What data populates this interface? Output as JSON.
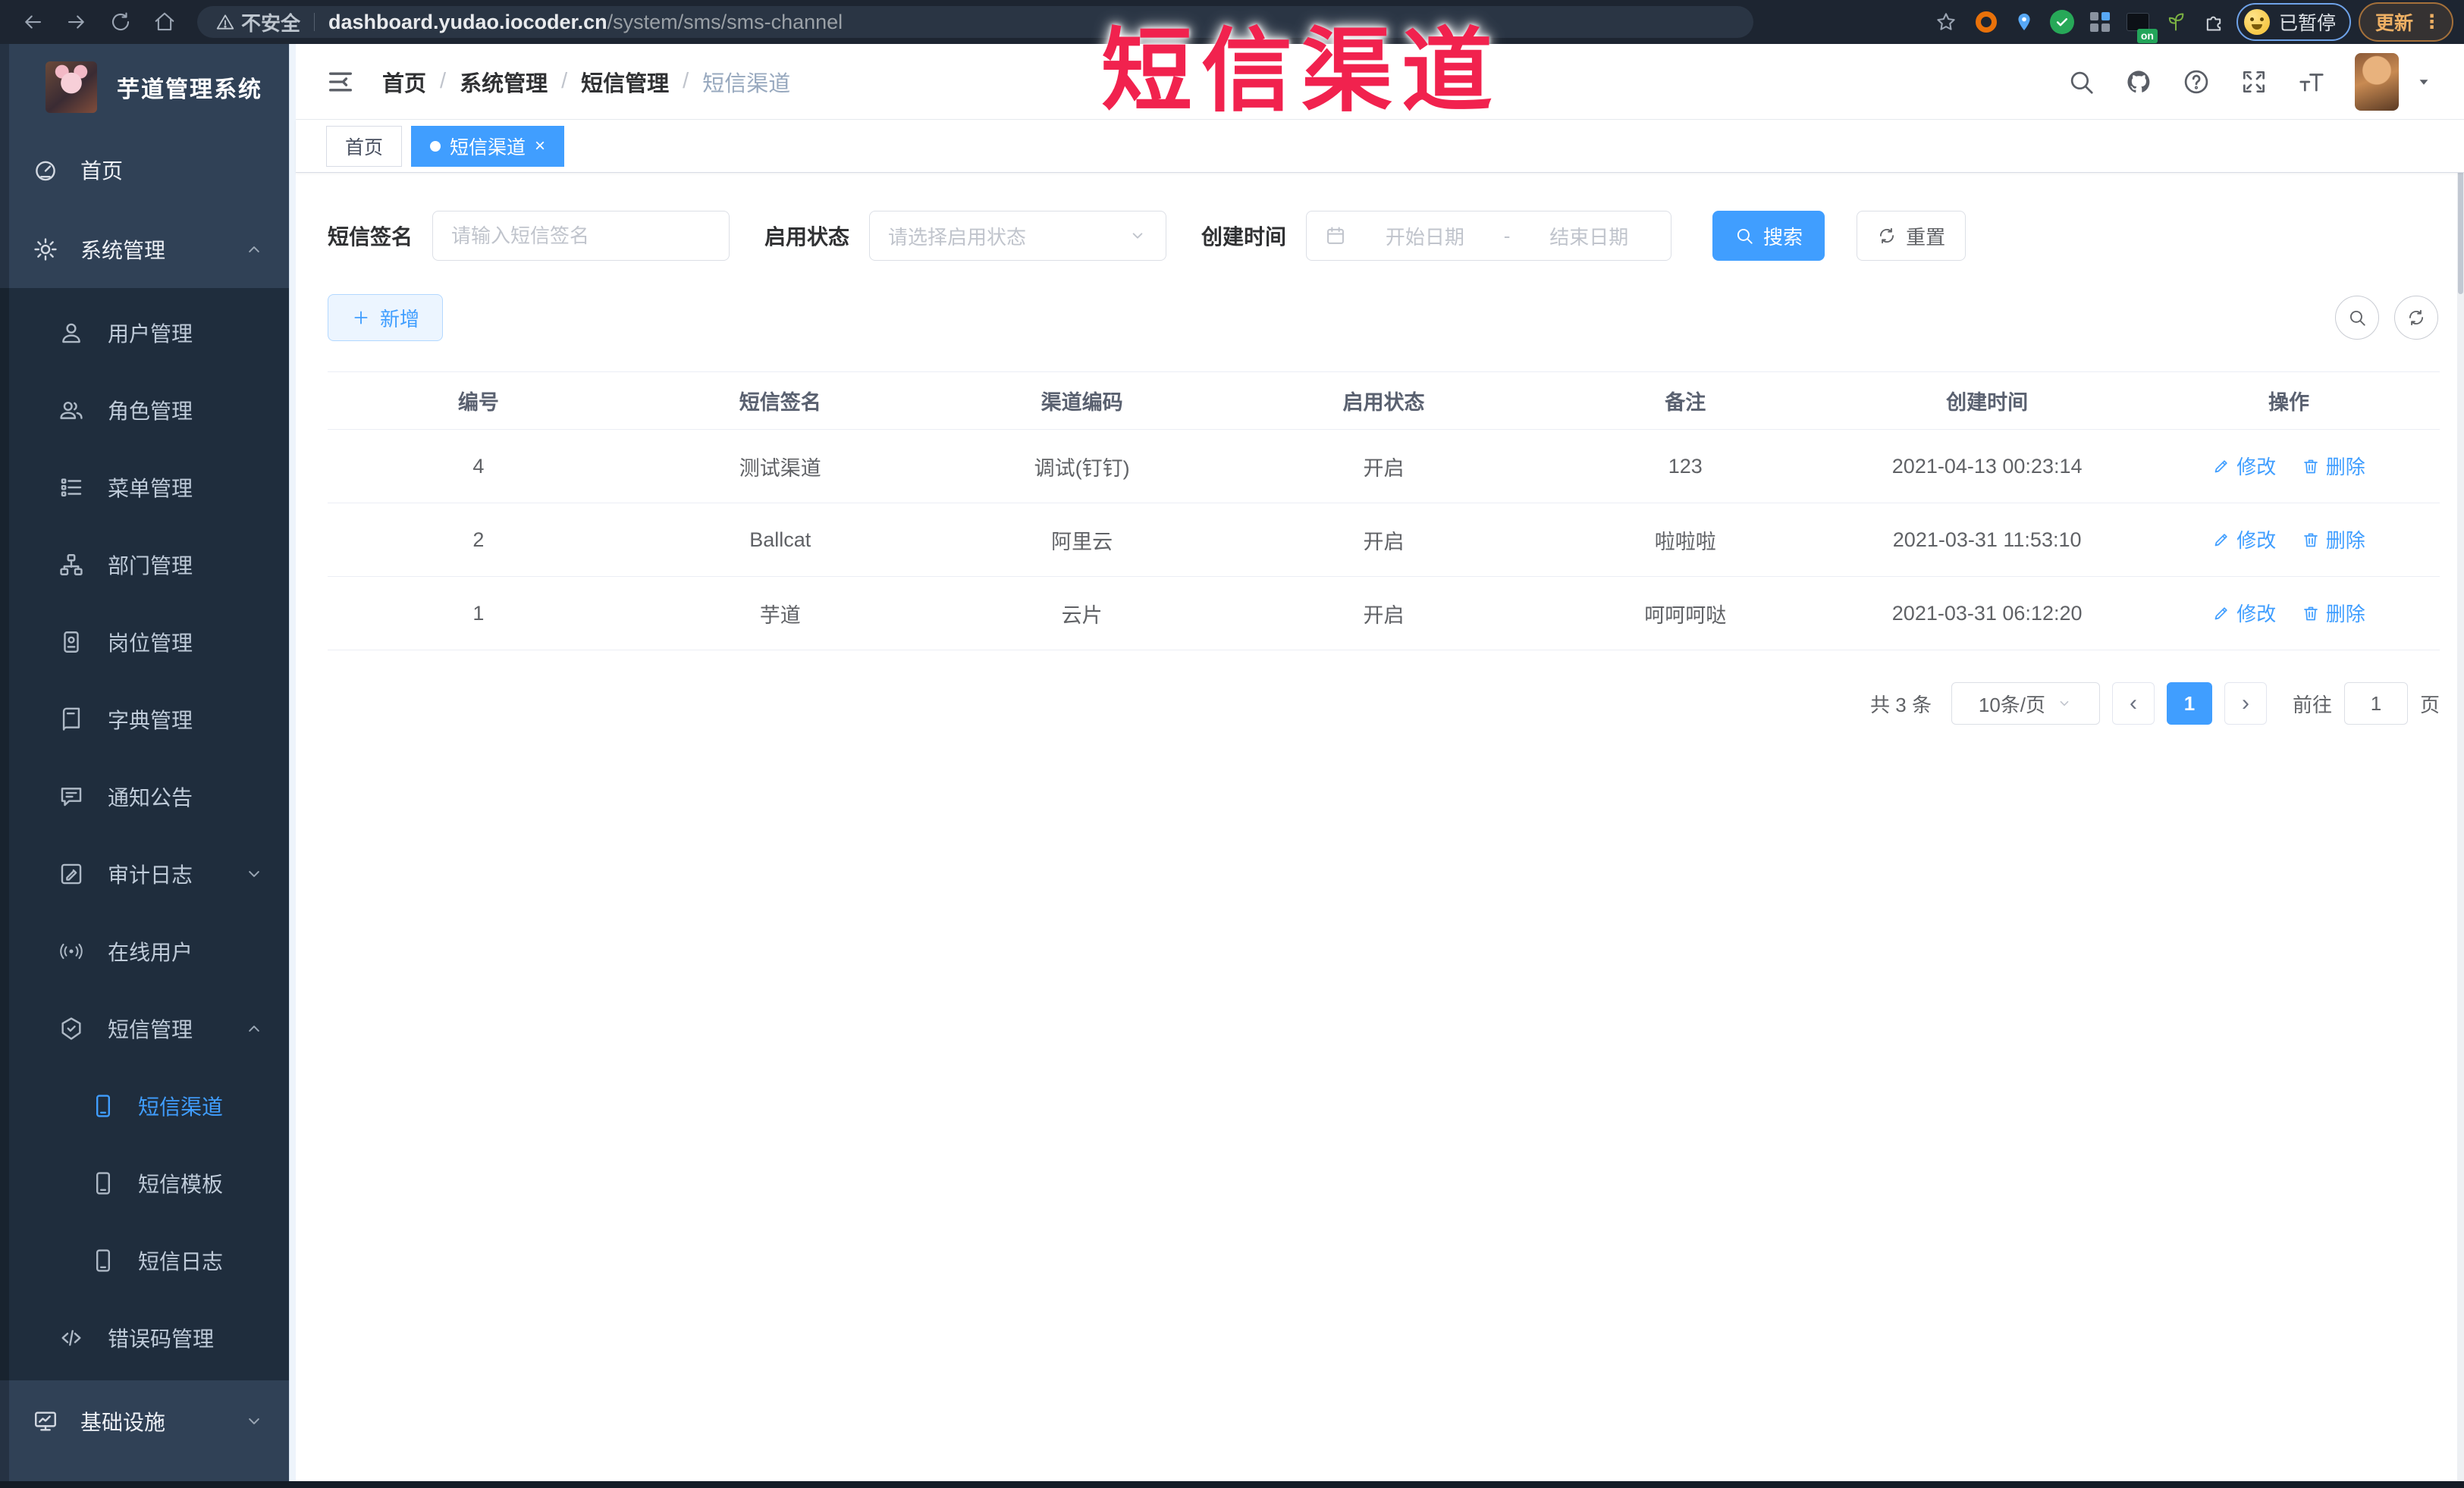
{
  "browser": {
    "security_label": "不安全",
    "url_domain": "dashboard.yudao.iocoder.cn",
    "url_path": "/system/sms/sms-channel",
    "extension_on_badge": "on",
    "paused_label": "已暂停",
    "update_label": "更新"
  },
  "watermark": {
    "text": "短信渠道",
    "color": "#f1224e"
  },
  "sidebar": {
    "title": "芋道管理系统",
    "items": [
      {
        "label": "首页"
      },
      {
        "label": "系统管理"
      },
      {
        "label": "用户管理"
      },
      {
        "label": "角色管理"
      },
      {
        "label": "菜单管理"
      },
      {
        "label": "部门管理"
      },
      {
        "label": "岗位管理"
      },
      {
        "label": "字典管理"
      },
      {
        "label": "通知公告"
      },
      {
        "label": "审计日志"
      },
      {
        "label": "在线用户"
      },
      {
        "label": "短信管理"
      },
      {
        "label": "短信渠道"
      },
      {
        "label": "短信模板"
      },
      {
        "label": "短信日志"
      },
      {
        "label": "错误码管理"
      },
      {
        "label": "基础设施"
      }
    ]
  },
  "header": {
    "breadcrumb": {
      "separator": "/",
      "items": [
        "首页",
        "系统管理",
        "短信管理",
        "短信渠道"
      ]
    }
  },
  "tabs": [
    {
      "label": "首页"
    },
    {
      "label": "短信渠道"
    }
  ],
  "filters": {
    "sign_label": "短信签名",
    "sign_placeholder": "请输入短信签名",
    "status_label": "启用状态",
    "status_placeholder": "请选择启用状态",
    "time_label": "创建时间",
    "date_start_placeholder": "开始日期",
    "date_separator": "-",
    "date_end_placeholder": "结束日期",
    "search_label": "搜索",
    "reset_label": "重置"
  },
  "toolbar": {
    "add_label": "新增"
  },
  "table": {
    "headers": [
      "编号",
      "短信签名",
      "渠道编码",
      "启用状态",
      "备注",
      "创建时间",
      "操作"
    ],
    "rows": [
      {
        "id": "4",
        "sign": "测试渠道",
        "code": "调试(钉钉)",
        "status": "开启",
        "remark": "123",
        "created": "2021-04-13 00:23:14"
      },
      {
        "id": "2",
        "sign": "Ballcat",
        "code": "阿里云",
        "status": "开启",
        "remark": "啦啦啦",
        "created": "2021-03-31 11:53:10"
      },
      {
        "id": "1",
        "sign": "芋道",
        "code": "云片",
        "status": "开启",
        "remark": "呵呵呵哒",
        "created": "2021-03-31 06:12:20"
      }
    ],
    "edit_label": "修改",
    "delete_label": "删除"
  },
  "pagination": {
    "total": "共 3 条",
    "page_size": "10条/页",
    "current_page": "1",
    "goto_label": "前往",
    "goto_value": "1",
    "page_unit": "页"
  },
  "colors": {
    "accent": "#409eff",
    "sidebar_dark": "#1f2d3d",
    "sidebar_light": "#304156"
  }
}
